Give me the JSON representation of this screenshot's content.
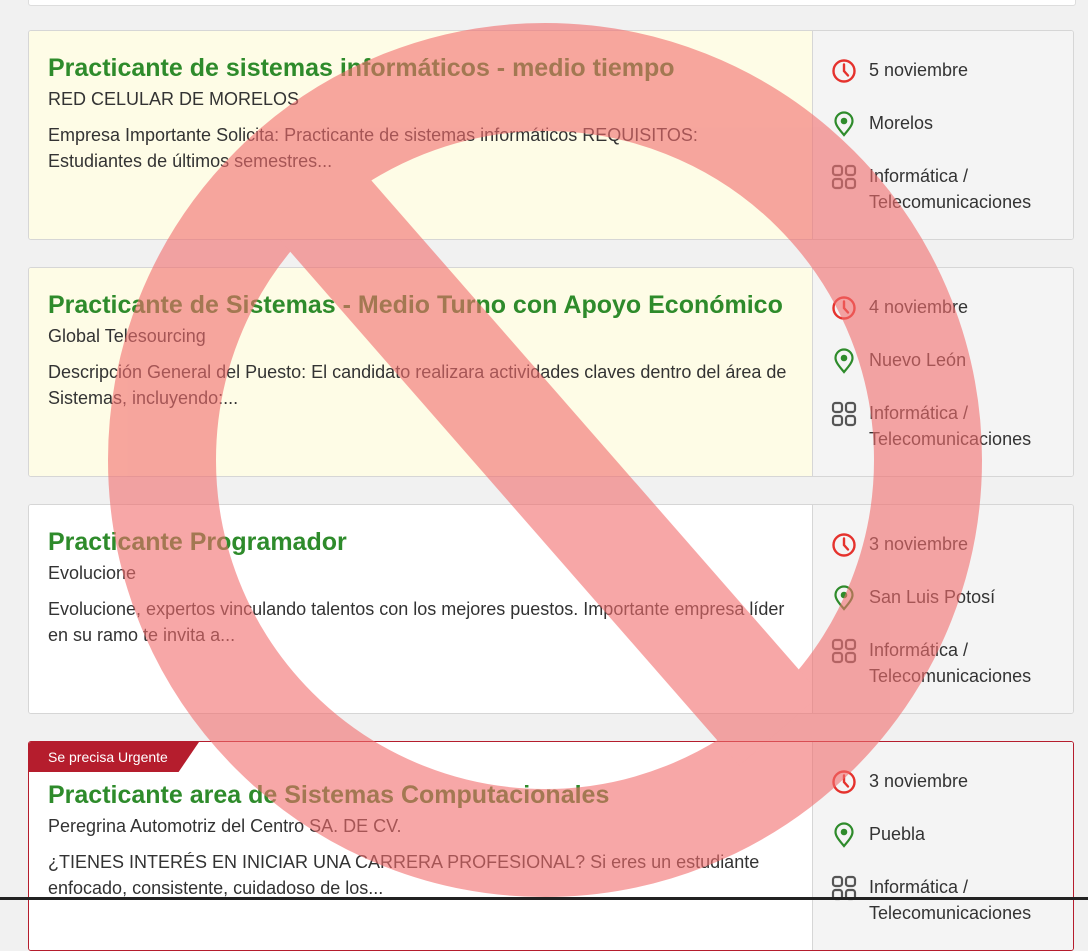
{
  "jobs": [
    {
      "title": "Practicante de sistemas informáticos - medio tiempo",
      "company": "RED CELULAR DE MORELOS",
      "description": "Empresa Importante Solicita: Practicante de sistemas informáticos REQUISITOS: Estudiantes de últimos semestres...",
      "date": "5 noviembre",
      "location": "Morelos",
      "category": "Informática / Telecomunicaciones"
    },
    {
      "title": "Practicante de Sistemas - Medio Turno con Apoyo Económico",
      "company": "Global Telesourcing",
      "description": "Descripción General del Puesto: El candidato realizara actividades claves dentro del área de Sistemas, incluyendo:...",
      "date": "4 noviembre",
      "location": "Nuevo León",
      "category": "Informática / Telecomunicaciones"
    },
    {
      "title": "Practicante Programador",
      "company": "Evolucione",
      "description": "Evolucione, expertos vinculando talentos con los mejores puestos. Importante empresa líder en su ramo te invita a...",
      "date": "3 noviembre",
      "location": "San Luis Potosí",
      "category": "Informática / Telecomunicaciones"
    },
    {
      "badge": "Se precisa Urgente",
      "title": "Practicante area de Sistemas Computacionales",
      "company": "Peregrina Automotriz del Centro SA. DE CV.",
      "description": "¿TIENES INTERÉS EN INICIAR UNA CARRERA PROFESIONAL? Si eres un estudiante enfocado, consistente, cuidadoso de los...",
      "date": "3 noviembre",
      "location": "Puebla",
      "category": "Informática / Telecomunicaciones"
    }
  ],
  "icons": {
    "date": "clock-icon",
    "location": "map-pin-icon",
    "category": "grid-icon"
  },
  "colors": {
    "title": "#2e8b2b",
    "highlight_bg": "#fefce6",
    "urgent": "#b51d2d",
    "icon_red": "#e5322d",
    "icon_green": "#2e8b2b",
    "prohibition_overlay": "#f26d6d"
  }
}
